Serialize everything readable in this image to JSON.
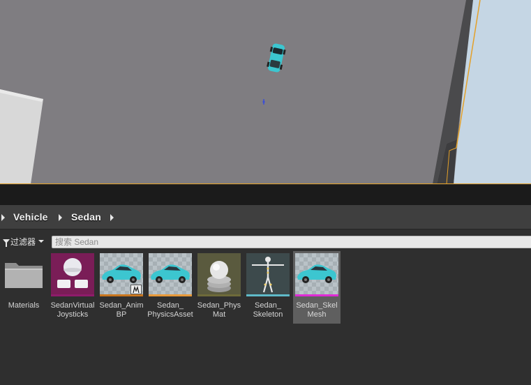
{
  "breadcrumb": {
    "items": [
      "Vehicle",
      "Sedan"
    ]
  },
  "filter": {
    "label": "过滤器",
    "search_placeholder": "搜索 Sedan"
  },
  "assets": [
    {
      "name_lines": [
        "Materials"
      ],
      "type": "folder",
      "strip_color": ""
    },
    {
      "name_lines": [
        "SedanVirtual",
        "Joysticks"
      ],
      "type": "touch-interface",
      "strip_color": "#8f1b6b"
    },
    {
      "name_lines": [
        "Sedan_Anim",
        "BP"
      ],
      "type": "animation-blueprint",
      "strip_color": "#c9761e"
    },
    {
      "name_lines": [
        "Sedan_",
        "PhysicsAsset"
      ],
      "type": "physics-asset",
      "strip_color": "#e89a3a"
    },
    {
      "name_lines": [
        "Sedan_Phys",
        "Mat"
      ],
      "type": "physical-material",
      "strip_color": "#6e6a3a"
    },
    {
      "name_lines": [
        "Sedan_",
        "Skeleton"
      ],
      "type": "skeleton",
      "strip_color": "#5fbac9"
    },
    {
      "name_lines": [
        "Sedan_Skel",
        "Mesh"
      ],
      "type": "skeletal-mesh",
      "strip_color": "#e02bd6",
      "selected": true
    }
  ],
  "colors": {
    "accent_border": "#e3a12a",
    "car_body": "#3cc6d0"
  }
}
